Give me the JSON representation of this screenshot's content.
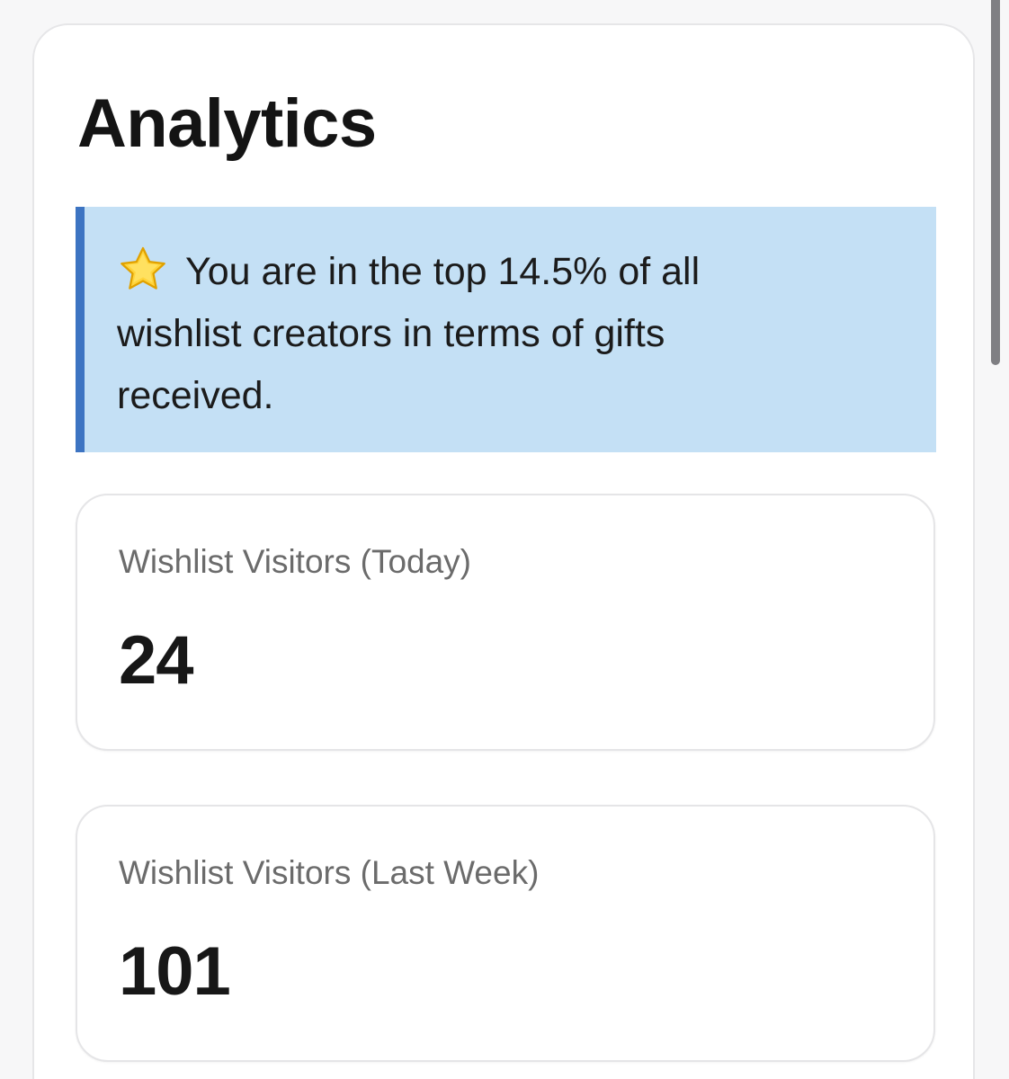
{
  "header": {
    "title": "Analytics"
  },
  "notice": {
    "icon": "star-icon",
    "text": "You are in the top 14.5% of all wishlist creators in terms of gifts received.",
    "background_color": "#c4e0f5",
    "accent_color": "#3d74c2"
  },
  "stats": [
    {
      "label": "Wishlist Visitors (Today)",
      "value": "24"
    },
    {
      "label": "Wishlist Visitors (Last Week)",
      "value": "101"
    }
  ]
}
